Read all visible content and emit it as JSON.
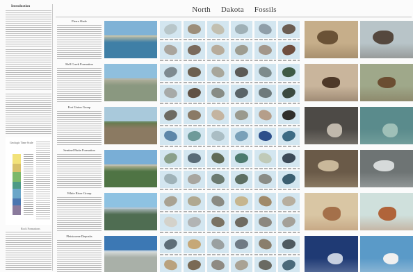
{
  "poster": {
    "title": "North Dakota Fossils",
    "left_heading": "Introduction",
    "stratigraphy_title": "Geologic Time Scale",
    "stratigraphy_caption": "Rock Formations"
  },
  "rows": [
    {
      "id": "row1",
      "label": "Pierre Shale",
      "landscape": {
        "sky": "#7fb2d6",
        "land": "#3f7fa6",
        "ridge": "#c9c3a6"
      },
      "fossil_tints": [
        "#b8c6c9",
        "#9c8e7a",
        "#c2bfb0",
        "#9fb0b6",
        "#8f9ea8",
        "#6b5d52",
        "#a9a49c",
        "#7a6a5c",
        "#b7ab9a",
        "#9d9c90",
        "#a2968a",
        "#6f4e3e"
      ],
      "art_left": {
        "bg": "#c6ae8a",
        "fg": "#6a5236"
      },
      "art_right": {
        "bg": "#b8c4c8",
        "fg": "#55483e"
      }
    },
    {
      "id": "row2",
      "label": "Hell Creek Formation",
      "landscape": {
        "sky": "#8fbfdd",
        "land": "#8a9880",
        "ridge": "#b7b3a0"
      },
      "fossil_tints": [
        "#7e8a90",
        "#6d6050",
        "#a8a69a",
        "#5c5a56",
        "#7d8b8c",
        "#3f5a45",
        "#a7aaa8",
        "#615245",
        "#878c86",
        "#5a6468",
        "#6e7a7c",
        "#3c4a40"
      ],
      "art_left": {
        "bg": "#c9b59c",
        "fg": "#4d3828"
      },
      "art_right": {
        "bg": "#9fa88a",
        "fg": "#6b4e32"
      }
    },
    {
      "id": "row3",
      "label": "Fort Union Group",
      "landscape": {
        "sky": "#a9c9db",
        "land": "#8b7a62",
        "ridge": "#5f7a4a"
      },
      "fossil_tints": [
        "#6d6b62",
        "#8a7a66",
        "#c4b4a0",
        "#9a9a8e",
        "#b59e8a",
        "#2f2e2b",
        "#5d86a8",
        "#6e9a9a",
        "#aabdc4",
        "#79a0b8",
        "#2d4f8a",
        "#3d6b84"
      ],
      "art_left": {
        "bg": "#4d4a46",
        "fg": "#c0b8ac"
      },
      "art_right": {
        "bg": "#5a8b8c",
        "fg": "#9fc0b8"
      }
    },
    {
      "id": "row4",
      "label": "Sentinel Butte Formation",
      "landscape": {
        "sky": "#79aed6",
        "land": "#4f7444",
        "ridge": "#c8c0a8"
      },
      "fossil_tints": [
        "#8aa08a",
        "#5a6c78",
        "#606a56",
        "#4d7a6e",
        "#c0cab8",
        "#3c4a58",
        "#9fb2b8",
        "#a8a6a0",
        "#6b7a70",
        "#5c6e62",
        "#8a8c86",
        "#3b5e70"
      ],
      "art_left": {
        "bg": "#6a5a48",
        "fg": "#c9b89a"
      },
      "art_right": {
        "bg": "#6e7474",
        "fg": "#d6dada"
      }
    },
    {
      "id": "row5",
      "label": "White River Group",
      "landscape": {
        "sky": "#8ec2e2",
        "land": "#4f6d52",
        "ridge": "#b9c4cc"
      },
      "fossil_tints": [
        "#a9a292",
        "#b0a890",
        "#8a8a82",
        "#c6b58e",
        "#a08a6a",
        "#b7ae9e",
        "#d4d2ca",
        "#b2b4b4",
        "#7a7262",
        "#6e6a60",
        "#8c8880",
        "#a4a098"
      ],
      "art_left": {
        "bg": "#d9c6a4",
        "fg": "#a4704a"
      },
      "art_right": {
        "bg": "#cfe0dc",
        "fg": "#b0643a"
      }
    },
    {
      "id": "row6",
      "label": "Pleistocene Deposits",
      "landscape": {
        "sky": "#3c78b4",
        "land": "#a9b0a8",
        "ridge": "#dfe4e4"
      },
      "fossil_tints": [
        "#5e6e78",
        "#c6a878",
        "#9aa0a0",
        "#6f7a84",
        "#8a7e6c",
        "#4e5a60",
        "#b9a27e",
        "#7a6a54",
        "#8e8a82",
        "#a9a294",
        "#6a6a62",
        "#4b6a7a"
      ],
      "art_left": {
        "bg": "#1f3a74",
        "fg": "#c6cfe0"
      },
      "art_right": {
        "bg": "#5a9ac8",
        "fg": "#f0f0f0"
      }
    }
  ],
  "colors": {
    "cell_background": "#d3e6f0",
    "rule": "#bdbdbd",
    "text_line": "#b8b8b8"
  }
}
